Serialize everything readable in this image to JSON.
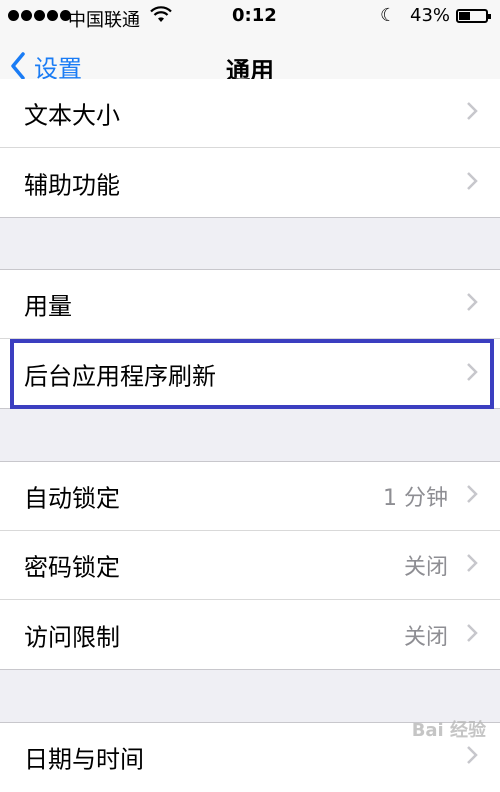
{
  "status_bar": {
    "carrier": "中国联通",
    "time": "0:12",
    "battery_percent": "43%",
    "battery_level": 0.43,
    "icons": [
      "signal-dots-icon",
      "wifi-icon",
      "moon-icon",
      "battery-icon"
    ]
  },
  "nav": {
    "back_label": "设置",
    "title": "通用",
    "accent_color": "#1a7cf5"
  },
  "groups": [
    {
      "rows": [
        {
          "label": "文本大小",
          "value": ""
        },
        {
          "label": "辅助功能",
          "value": ""
        }
      ]
    },
    {
      "rows": [
        {
          "label": "用量",
          "value": ""
        },
        {
          "label": "后台应用程序刷新",
          "value": ""
        }
      ]
    },
    {
      "rows": [
        {
          "label": "自动锁定",
          "value": "1 分钟"
        },
        {
          "label": "密码锁定",
          "value": "关闭"
        },
        {
          "label": "访问限制",
          "value": "关闭"
        }
      ]
    },
    {
      "rows": [
        {
          "label": "日期与时间",
          "value": ""
        }
      ]
    }
  ],
  "highlight_color": "#3b3ec0",
  "watermark": "Bai 经验"
}
